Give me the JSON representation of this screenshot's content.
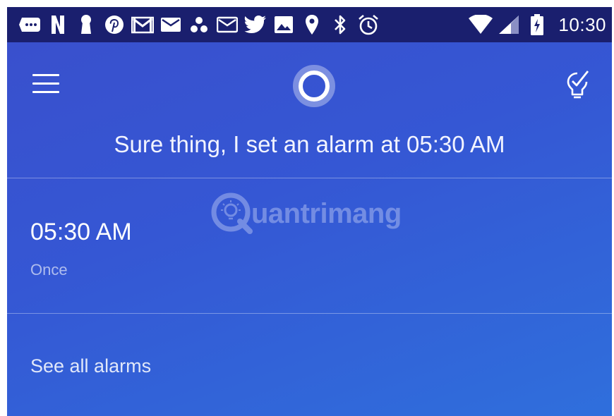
{
  "status_bar": {
    "icons": [
      "message-icon",
      "netflix-icon",
      "keyhole-icon",
      "pinterest-icon",
      "gmail-icon",
      "mail-icon",
      "app-icon",
      "mail-icon",
      "twitter-icon",
      "image-icon",
      "location-icon",
      "bluetooth-icon",
      "alarm-icon",
      "wifi-icon",
      "signal-icon",
      "battery-icon"
    ],
    "time": "10:30"
  },
  "header": {
    "menu_icon": "hamburger-icon",
    "assistant_icon": "cortana-ring-icon",
    "tasks_icon": "lightbulb-check-icon"
  },
  "response": {
    "text": "Sure thing, I set an alarm at 05:30 AM"
  },
  "alarm": {
    "time": "05:30 AM",
    "repeat": "Once"
  },
  "footer": {
    "see_all": "See all alarms"
  },
  "watermark": {
    "text": "uantrimang"
  },
  "colors": {
    "status_bar": "#1a1f6e",
    "background": "#3557d4",
    "text": "#ffffff"
  }
}
